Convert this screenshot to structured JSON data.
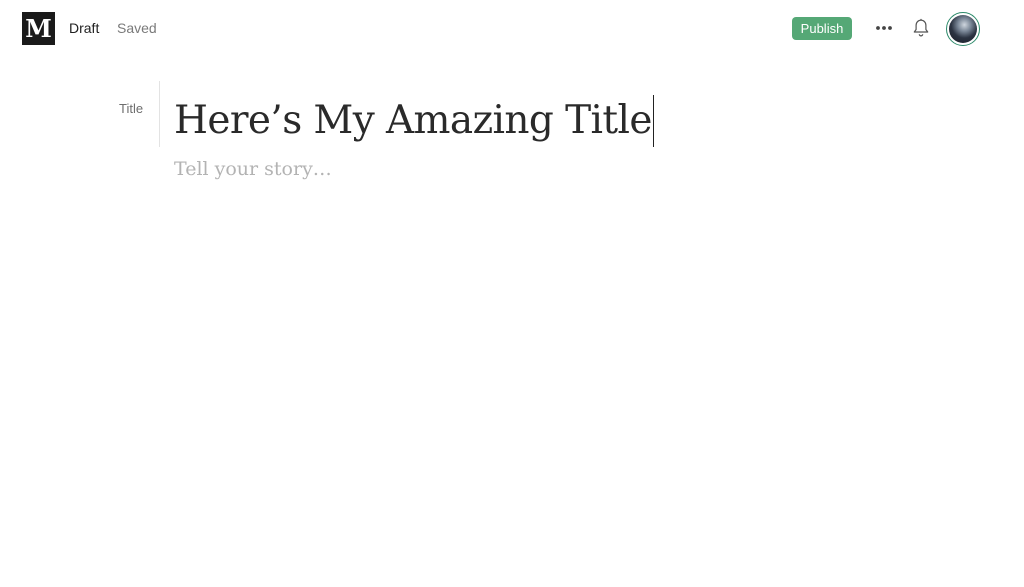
{
  "header": {
    "logo_letter": "M",
    "draft_label": "Draft",
    "save_status": "Saved",
    "publish_label": "Publish",
    "more_icon": "more-horizontal-icon",
    "bell_icon": "bell-icon"
  },
  "editor": {
    "title_label": "Title",
    "title_value": "Here’s My Amazing Title",
    "story_placeholder": "Tell your story…"
  },
  "colors": {
    "publish_button": "#55a876",
    "avatar_ring": "#2c8a6a",
    "logo_bg": "#1a1a1a"
  }
}
